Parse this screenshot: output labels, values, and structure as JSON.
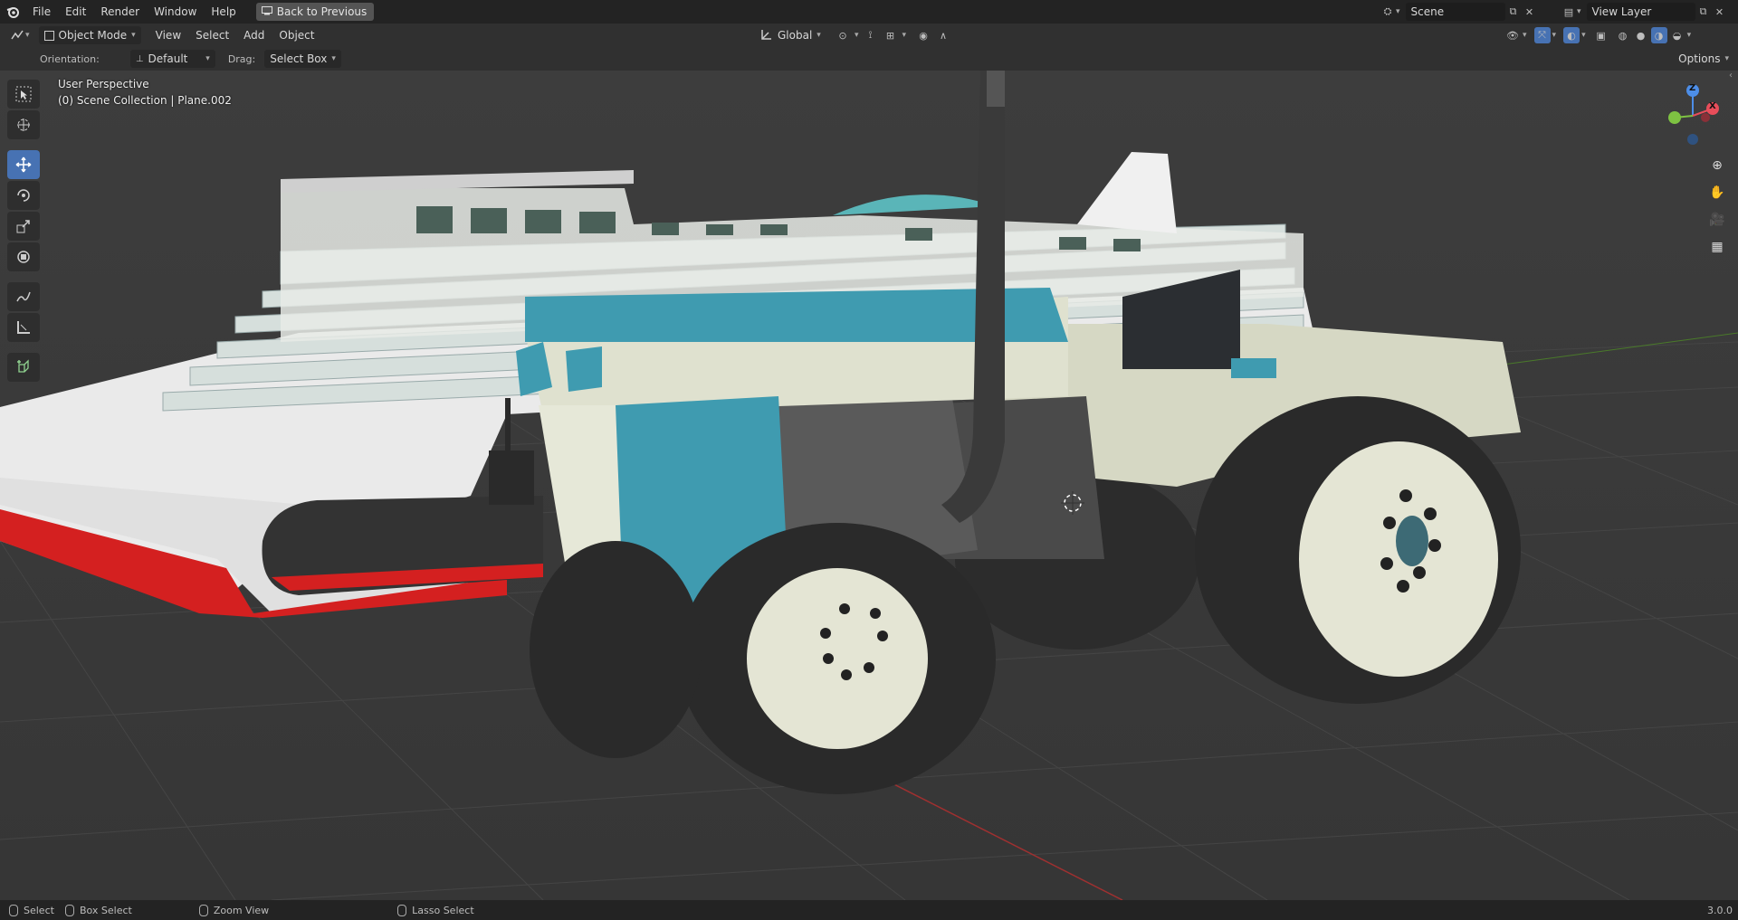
{
  "menubar": {
    "items": [
      "File",
      "Edit",
      "Render",
      "Window",
      "Help"
    ],
    "back_button": "Back to Previous",
    "scene": "Scene",
    "view_layer": "View Layer"
  },
  "header": {
    "mode": "Object Mode",
    "menus": [
      "View",
      "Select",
      "Add",
      "Object"
    ],
    "transform_orientation": "Global"
  },
  "tool_settings": {
    "orientation_label": "Orientation:",
    "orientation_value": "Default",
    "drag_label": "Drag:",
    "drag_value": "Select Box",
    "options": "Options"
  },
  "viewport": {
    "perspective": "User Perspective",
    "collection": "(0) Scene Collection | Plane.002"
  },
  "gizmo": {
    "z": "Z",
    "x": "X",
    "y": "Y"
  },
  "statusbar": {
    "select": "Select",
    "box_select": "Box Select",
    "zoom_view": "Zoom View",
    "lasso_select": "Lasso Select",
    "version": "3.0.0"
  },
  "colors": {
    "accent": "#4772b3",
    "teal": "#3f9bb0",
    "cream": "#dfe1cf",
    "hull_red": "#cc2222"
  }
}
